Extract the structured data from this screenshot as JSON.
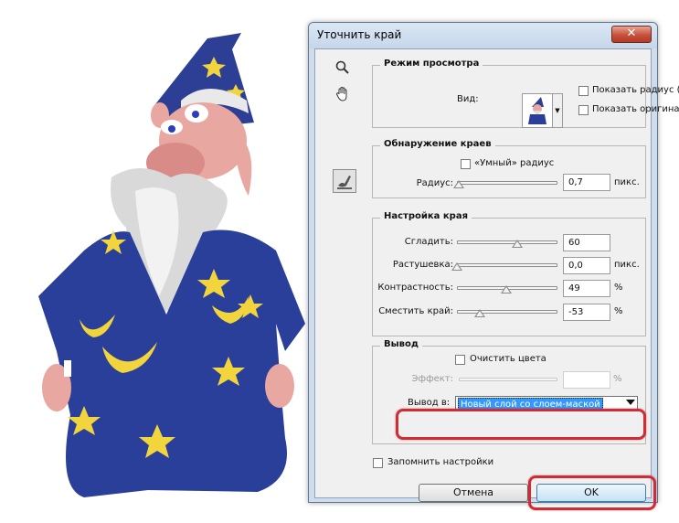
{
  "dialog": {
    "title": "Уточнить край",
    "close_glyph": "✕"
  },
  "tools": {
    "zoom_icon": "zoom-tool-icon",
    "hand_icon": "hand-tool-icon",
    "radius_icon": "refine-radius-tool-icon"
  },
  "view_mode": {
    "title": "Режим просмотра",
    "view_label": "Вид:",
    "show_radius": "Показать радиус (J)",
    "show_original": "Показать оригинал (P)"
  },
  "edge_detection": {
    "title": "Обнаружение краев",
    "smart_radius": "«Умный» радиус",
    "radius_label": "Радиус:",
    "radius_value": "0,7",
    "radius_unit": "пикс.",
    "radius_level": 0.02
  },
  "adjust_edge": {
    "title": "Настройка края",
    "rows": [
      {
        "label": "Сгладить:",
        "value": "60",
        "unit": "",
        "level": 0.6
      },
      {
        "label": "Растушевка:",
        "value": "0,0",
        "unit": "пикс.",
        "level": 0.0
      },
      {
        "label": "Контрастность:",
        "value": "49",
        "unit": "%",
        "level": 0.49
      },
      {
        "label": "Сместить край:",
        "value": "-53",
        "unit": "%",
        "level": 0.23
      }
    ]
  },
  "output": {
    "title": "Вывод",
    "decontaminate": "Очистить цвета",
    "effect_label": "Эффект:",
    "effect_unit": "%",
    "output_to_label": "Вывод в:",
    "output_to_value": "Новый слой со слоем-маской"
  },
  "remember_settings": "Запомнить настройки",
  "buttons": {
    "cancel": "Отмена",
    "ok": "OK"
  },
  "colors": {
    "highlight": "#d12b35",
    "selection": "#3399ff",
    "robe": "#2a3f9a",
    "star": "#f2d53c"
  }
}
